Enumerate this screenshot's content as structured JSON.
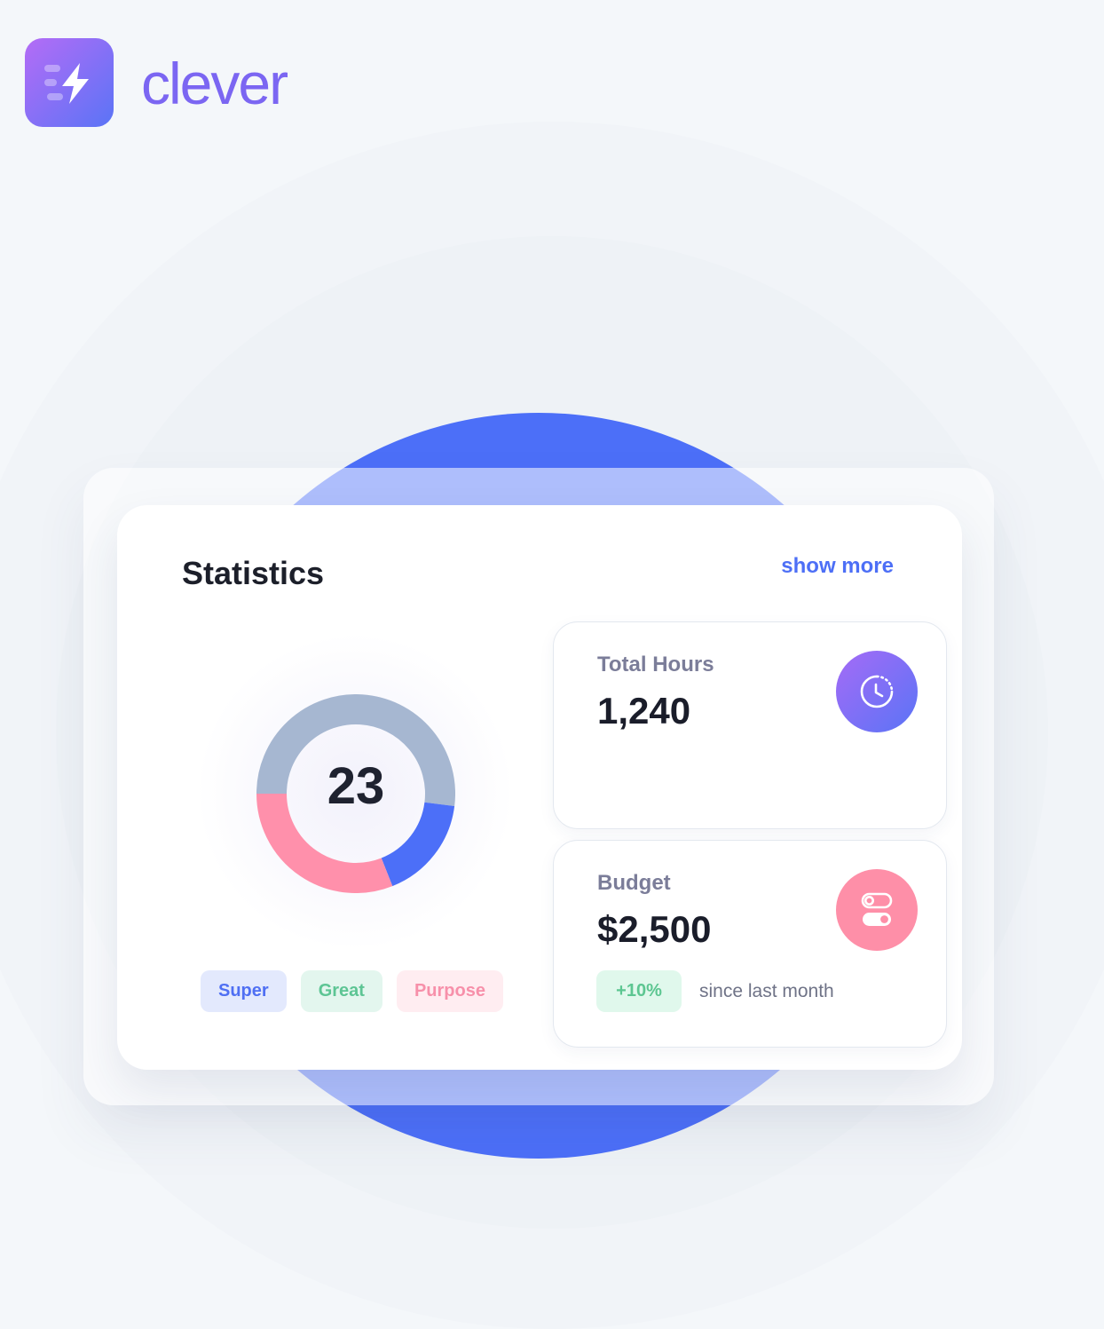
{
  "brand": {
    "name": "clever",
    "logo_icon": "lightning-bolt-icon"
  },
  "colors": {
    "accent": "#4d6ff6",
    "donut_super": "#4c6ff8",
    "donut_great": "#a6b7d1",
    "donut_purpose": "#ff90ab"
  },
  "statistics": {
    "title": "Statistics",
    "show_more": "show more"
  },
  "chart_data": {
    "type": "pie",
    "center_value": "23",
    "categories": [
      "Great",
      "Super",
      "Purpose"
    ],
    "values": [
      52,
      17,
      31
    ],
    "legend": [
      "Super",
      "Great",
      "Purpose"
    ]
  },
  "cards": {
    "total_hours": {
      "label": "Total Hours",
      "value": "1,240",
      "icon": "clock-icon"
    },
    "budget": {
      "label": "Budget",
      "value": "$2,500",
      "icon": "toggle-icon",
      "change": "+10%",
      "change_note": "since last month"
    }
  }
}
